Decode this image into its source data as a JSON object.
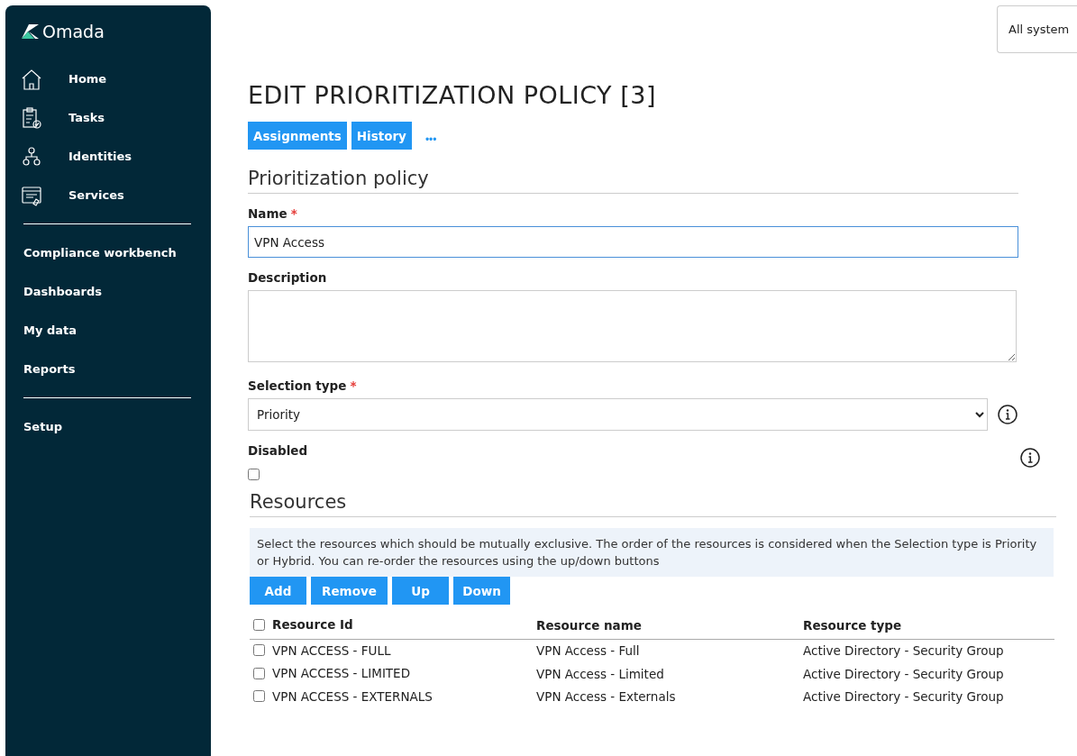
{
  "sidebar": {
    "logo": "Omada",
    "groups": [
      [
        "Home",
        "Tasks",
        "Identities",
        "Services"
      ],
      [
        "Compliance workbench",
        "Dashboards",
        "My data",
        "Reports"
      ],
      [
        "Setup"
      ]
    ]
  },
  "system_selector": {
    "value": "All system"
  },
  "page": {
    "title": "EDIT PRIORITIZATION POLICY [3]",
    "actions": [
      "Assignments",
      "History"
    ],
    "more": "•••"
  },
  "form": {
    "section": "Prioritization policy",
    "name": {
      "label": "Name",
      "required_mark": "*",
      "value": "VPN Access",
      "focused": true
    },
    "description": {
      "label": "Description"
    },
    "selection_type": {
      "label": "Selection type",
      "required_mark": "*",
      "value": "Priority"
    },
    "disabled": {
      "label": "Disabled",
      "checked": false
    }
  },
  "resources": {
    "section": "Resources",
    "info": "Select the resources which should be mutually exclusive. The order of the resources is considered when the Selection type is Priority or Hybrid. You can re-order the resources using the up/down buttons",
    "buttons": [
      "Add",
      "Remove",
      "Up",
      "Down"
    ],
    "select_all": false,
    "columns": [
      "Resource Id",
      "Resource name",
      "Resource type"
    ],
    "rows": [
      {
        "checked": false,
        "cells": [
          "VPN ACCESS - FULL",
          "VPN Access - Full",
          "Active Directory - Security Group"
        ]
      },
      {
        "checked": false,
        "cells": [
          "VPN ACCESS - LIMITED",
          "VPN Access - Limited",
          "Active Directory - Security Group"
        ]
      },
      {
        "checked": false,
        "cells": [
          "VPN ACCESS - EXTERNALS",
          "VPN Access - Externals",
          "Active Directory - Security Group"
        ]
      }
    ]
  }
}
